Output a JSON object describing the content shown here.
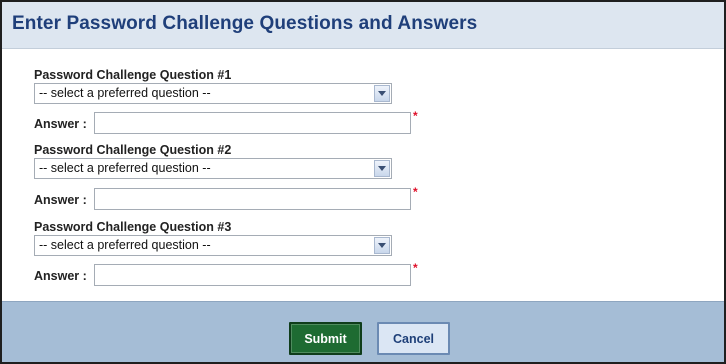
{
  "header": {
    "title": "Enter Password Challenge Questions and Answers"
  },
  "questions": [
    {
      "label": "Password Challenge Question #1",
      "selected": "-- select a preferred question --",
      "answer_label": "Answer :",
      "answer_value": ""
    },
    {
      "label": "Password Challenge Question #2",
      "selected": "-- select a preferred question --",
      "answer_label": "Answer :",
      "answer_value": ""
    },
    {
      "label": "Password Challenge Question #3",
      "selected": "-- select a preferred question --",
      "answer_label": "Answer :",
      "answer_value": ""
    }
  ],
  "required_marker": "*",
  "footer": {
    "submit_label": "Submit",
    "cancel_label": "Cancel"
  },
  "colors": {
    "header_bg": "#dde6f0",
    "title": "#1f3f7a",
    "footer_bg": "#a5bdd6",
    "submit_bg": "#1e6b32",
    "cancel_bg": "#dbe6f4",
    "required": "#e0102a"
  }
}
